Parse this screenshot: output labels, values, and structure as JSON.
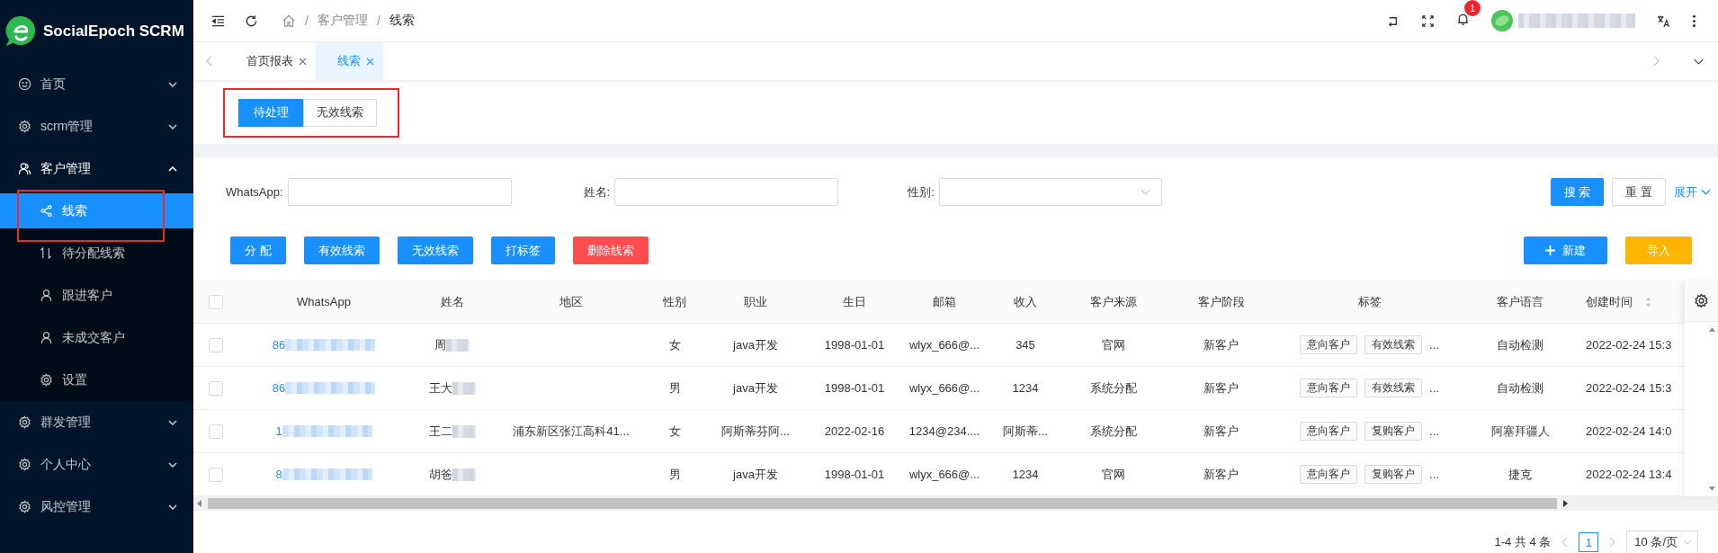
{
  "sidebar": {
    "logo": "SocialEpoch SCRM",
    "items": [
      {
        "label": "首页",
        "expanded": false
      },
      {
        "label": "scrm管理",
        "expanded": false
      },
      {
        "label": "客户管理",
        "expanded": true,
        "children": [
          {
            "label": "线索",
            "selected": true
          },
          {
            "label": "待分配线索",
            "selected": false
          },
          {
            "label": "跟进客户",
            "selected": false
          },
          {
            "label": "未成交客户",
            "selected": false
          },
          {
            "label": "设置",
            "selected": false
          }
        ]
      },
      {
        "label": "群发管理",
        "expanded": false
      },
      {
        "label": "个人中心",
        "expanded": false
      },
      {
        "label": "风控管理",
        "expanded": false
      }
    ]
  },
  "header": {
    "breadcrumb": [
      "客户管理",
      "线索"
    ],
    "separator": "/",
    "notifications": "1"
  },
  "tabs": [
    {
      "label": "首页报表",
      "selected": false
    },
    {
      "label": "线索",
      "selected": true
    }
  ],
  "segments": [
    {
      "label": "待处理",
      "selected": true
    },
    {
      "label": "无效线索",
      "selected": false
    }
  ],
  "filters": [
    {
      "label": "WhatsApp:",
      "kind": "input"
    },
    {
      "label": "姓名:",
      "kind": "input"
    },
    {
      "label": "性别:",
      "kind": "select"
    }
  ],
  "search_buttons": [
    {
      "label": "搜 索",
      "kind": "primary"
    },
    {
      "label": "重 置",
      "kind": "default"
    }
  ],
  "expand_link": "展开",
  "actions_left": [
    {
      "label": "分 配",
      "kind": "primary"
    },
    {
      "label": "有效线索",
      "kind": "primary"
    },
    {
      "label": "无效线索",
      "kind": "primary"
    },
    {
      "label": "打标签",
      "kind": "primary"
    },
    {
      "label": "删除线索",
      "kind": "danger"
    }
  ],
  "actions_right": [
    {
      "label": "新建",
      "kind": "primary"
    },
    {
      "label": "导入",
      "kind": "warning"
    }
  ],
  "table": {
    "select_all_checked": false,
    "columns": [
      "WhatsApp",
      "姓名",
      "地区",
      "性别",
      "职业",
      "生日",
      "邮箱",
      "收入",
      "客户来源",
      "客户阶段",
      "标签",
      "客户语言",
      "创建时间"
    ],
    "rows": [
      {
        "checked": false,
        "whatsapp": "86",
        "name": "周",
        "gender": "女",
        "job": "java开发",
        "birthday": "1998-01-01",
        "email": "wlyx_666@...",
        "income": "345",
        "source": "官网",
        "stage": "新客户",
        "tags": [
          "意向客户",
          "有效线索"
        ],
        "tags_more": "...",
        "language": "自动检测",
        "created": "2022-02-24 15:3"
      },
      {
        "checked": false,
        "whatsapp": "86",
        "name": "王大",
        "gender": "男",
        "job": "java开发",
        "birthday": "1998-01-01",
        "email": "wlyx_666@...",
        "income": "1234",
        "source": "系统分配",
        "stage": "新客户",
        "tags": [
          "意向客户",
          "有效线索"
        ],
        "tags_more": "...",
        "language": "自动检测",
        "created": "2022-02-24 15:3"
      },
      {
        "checked": false,
        "whatsapp": "1",
        "name": "王二",
        "region": "浦东新区张江高科41...",
        "gender": "女",
        "job": "阿斯蒂芬阿...",
        "birthday": "2022-02-16",
        "email": "1234@234....",
        "income": "阿斯蒂...",
        "source": "系统分配",
        "stage": "新客户",
        "tags": [
          "意向客户",
          "复购客户"
        ],
        "tags_more": "...",
        "language": "阿塞拜疆人",
        "created": "2022-02-24 14:0"
      },
      {
        "checked": false,
        "whatsapp": "8",
        "name": "胡爸",
        "gender": "男",
        "job": "java开发",
        "birthday": "1998-01-01",
        "email": "wlyx_666@...",
        "income": "1234",
        "source": "官网",
        "stage": "新客户",
        "tags": [
          "意向客户",
          "复购客户"
        ],
        "tags_more": "...",
        "language": "捷克",
        "created": "2022-02-24 13:4"
      }
    ]
  },
  "pagination": {
    "summary": "1-4 共 4 条",
    "pages": [
      {
        "label": "1",
        "selected": true
      }
    ],
    "page_size": "10 条/页"
  }
}
